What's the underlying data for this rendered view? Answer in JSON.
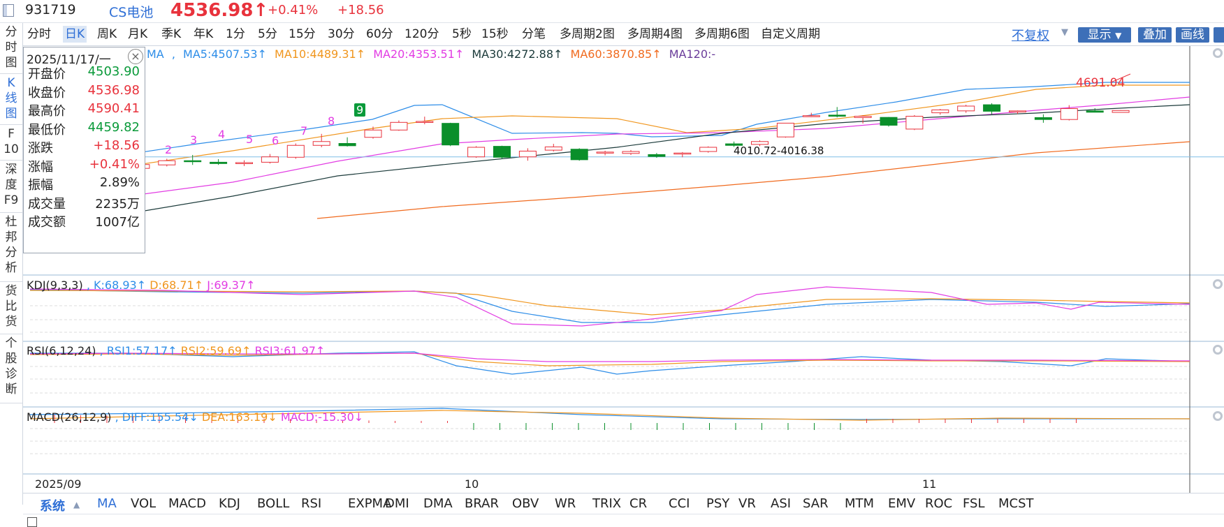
{
  "header": {
    "code": "931719",
    "name": "CS电池",
    "price": "4536.98↑",
    "pct_change": "+0.41%",
    "change": "+18.56"
  },
  "left_tabs": [
    {
      "label": "分\n时\n图"
    },
    {
      "label": "K\n线\n图"
    },
    {
      "label": "F\n10"
    },
    {
      "label": "深\n度\nF9"
    },
    {
      "label": "杜\n邦\n分\n析"
    },
    {
      "label": "货\n比\n货"
    },
    {
      "label": "个\n股\n诊\n断"
    }
  ],
  "periods": [
    "分时",
    "日K",
    "周K",
    "月K",
    "季K",
    "年K",
    "1分",
    "5分",
    "15分",
    "30分",
    "60分",
    "120分",
    "5秒",
    "15秒",
    "分笔",
    "多周期2图",
    "多周期4图",
    "多周期6图",
    "自定义周期"
  ],
  "active_period": "日K",
  "right_tools": {
    "no_adjust": "不复权",
    "display": "显示",
    "overlay": "叠加",
    "draw": "画线"
  },
  "ma_legend": {
    "prefix": "MA",
    "items": [
      {
        "text": "MA5:4507.53↑",
        "color": "#2d8de8"
      },
      {
        "text": "MA10:4489.31↑",
        "color": "#f0961e"
      },
      {
        "text": "MA20:4353.51↑",
        "color": "#e23ce3"
      },
      {
        "text": "MA30:4272.88↑",
        "color": "#1b3a3a"
      },
      {
        "text": "MA60:3870.85↑",
        "color": "#f06a1e"
      },
      {
        "text": "MA120:-",
        "color": "#6a3c9a"
      }
    ]
  },
  "info_box": {
    "date": "2025/11/17/一",
    "rows": [
      {
        "k": "开盘价",
        "v": "4503.90",
        "c": "dn"
      },
      {
        "k": "收盘价",
        "v": "4536.98",
        "c": "up"
      },
      {
        "k": "最高价",
        "v": "4590.41",
        "c": "up"
      },
      {
        "k": "最低价",
        "v": "4459.82",
        "c": "dn"
      },
      {
        "k": "涨跌",
        "v": "+18.56",
        "c": "up"
      },
      {
        "k": "涨幅",
        "v": "+0.41%",
        "c": "up"
      },
      {
        "k": "振幅",
        "v": "2.89%",
        "c": "blk"
      },
      {
        "k": "成交量",
        "v": "2235万",
        "c": "blk"
      },
      {
        "k": "成交额",
        "v": "1007亿",
        "c": "blk"
      }
    ]
  },
  "annotations": {
    "high_label": "4691.04",
    "low_label": "4010.72-4016.38",
    "seq_numbers": [
      "2",
      "3",
      "4",
      "5",
      "6",
      "7",
      "8",
      "9"
    ]
  },
  "kdj": {
    "title": "KDJ(9,3,3)",
    "k": "K:68.93↑",
    "d": "D:68.71↑",
    "j": "J:69.37↑"
  },
  "rsi": {
    "title": "RSI(6,12,24)",
    "r1": "RSI1:57.17↑",
    "r2": "RSI2:59.69↑",
    "r3": "RSI3:61.97↑"
  },
  "macd": {
    "title": "MACD(26,12,9)",
    "diff": "DIFF:155.54↓",
    "dea": "DEA:163.19↓",
    "macd": "MACD:-15.30↓"
  },
  "date_axis": [
    "2025/09",
    "10",
    "11"
  ],
  "indicator_bar": {
    "system": "系统",
    "items": [
      "MA",
      "VOL",
      "MACD",
      "KDJ",
      "BOLL",
      "RSI",
      "EXPMA",
      "DMI",
      "DMA",
      "BRAR",
      "OBV",
      "WR",
      "TRIX",
      "CR",
      "CCI",
      "PSY",
      "VR",
      "ASI",
      "SAR",
      "MTM",
      "EMV",
      "ROC",
      "FSL",
      "MCST"
    ],
    "selected": "MA"
  },
  "chart_data": {
    "type": "candlestick",
    "candles": [
      {
        "o": 4085,
        "c": 4100,
        "h": 4110,
        "l": 4078
      },
      {
        "o": 4100,
        "c": 4120,
        "h": 4130,
        "l": 4092
      },
      {
        "o": 4118,
        "c": 4140,
        "h": 4150,
        "l": 4110
      },
      {
        "o": 4140,
        "c": 4135,
        "h": 4170,
        "l": 4118
      },
      {
        "o": 4132,
        "c": 4125,
        "h": 4148,
        "l": 4118
      },
      {
        "o": 4125,
        "c": 4130,
        "h": 4142,
        "l": 4112
      },
      {
        "o": 4132,
        "c": 4160,
        "h": 4175,
        "l": 4125
      },
      {
        "o": 4158,
        "c": 4220,
        "h": 4230,
        "l": 4150
      },
      {
        "o": 4220,
        "c": 4240,
        "h": 4280,
        "l": 4210
      },
      {
        "o": 4230,
        "c": 4218,
        "h": 4262,
        "l": 4214
      },
      {
        "o": 4262,
        "c": 4300,
        "h": 4318,
        "l": 4255
      },
      {
        "o": 4300,
        "c": 4340,
        "h": 4350,
        "l": 4296
      },
      {
        "o": 4340,
        "c": 4345,
        "h": 4370,
        "l": 4330
      },
      {
        "o": 4335,
        "c": 4222,
        "h": 4338,
        "l": 4216
      },
      {
        "o": 4160,
        "c": 4210,
        "h": 4216,
        "l": 4155
      },
      {
        "o": 4215,
        "c": 4158,
        "h": 4218,
        "l": 4150
      },
      {
        "o": 4160,
        "c": 4190,
        "h": 4205,
        "l": 4140
      },
      {
        "o": 4195,
        "c": 4212,
        "h": 4228,
        "l": 4188
      },
      {
        "o": 4200,
        "c": 4145,
        "h": 4205,
        "l": 4140
      },
      {
        "o": 4180,
        "c": 4185,
        "h": 4192,
        "l": 4168
      },
      {
        "o": 4178,
        "c": 4188,
        "h": 4196,
        "l": 4170
      },
      {
        "o": 4172,
        "c": 4162,
        "h": 4180,
        "l": 4155
      },
      {
        "o": 4175,
        "c": 4180,
        "h": 4185,
        "l": 4158
      },
      {
        "o": 4188,
        "c": 4210,
        "h": 4215,
        "l": 4182
      },
      {
        "o": 4228,
        "c": 4220,
        "h": 4240,
        "l": 4212
      },
      {
        "o": 4225,
        "c": 4240,
        "h": 4246,
        "l": 4216
      },
      {
        "o": 4264,
        "c": 4336,
        "h": 4336,
        "l": 4260
      },
      {
        "o": 4375,
        "c": 4375,
        "h": 4390,
        "l": 4368
      },
      {
        "o": 4378,
        "c": 4372,
        "h": 4420,
        "l": 4366
      },
      {
        "o": 4365,
        "c": 4372,
        "h": 4376,
        "l": 4334
      },
      {
        "o": 4366,
        "c": 4325,
        "h": 4368,
        "l": 4318
      },
      {
        "o": 4305,
        "c": 4372,
        "h": 4378,
        "l": 4300
      },
      {
        "o": 4390,
        "c": 4405,
        "h": 4410,
        "l": 4380
      },
      {
        "o": 4400,
        "c": 4425,
        "h": 4432,
        "l": 4390
      },
      {
        "o": 4432,
        "c": 4398,
        "h": 4440,
        "l": 4378
      },
      {
        "o": 4398,
        "c": 4400,
        "h": 4402,
        "l": 4384
      },
      {
        "o": 4365,
        "c": 4355,
        "h": 4382,
        "l": 4338
      },
      {
        "o": 4355,
        "c": 4412,
        "h": 4430,
        "l": 4350
      },
      {
        "o": 4400,
        "c": 4393,
        "h": 4414,
        "l": 4392
      },
      {
        "o": 4392,
        "c": 4402,
        "h": 4404,
        "l": 4392
      }
    ],
    "price_range": [
      3700,
      4720
    ],
    "reference_line": 4160,
    "annotations": [
      "4691.04",
      "4010.72-4016.38"
    ]
  }
}
